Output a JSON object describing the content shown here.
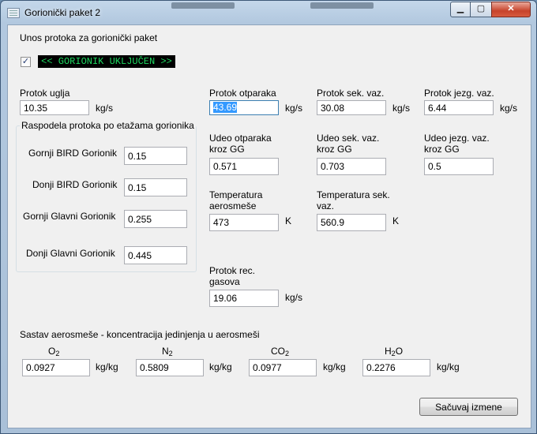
{
  "window": {
    "title": "Gorionički paket 2"
  },
  "caption_buttons": {
    "minimize": "▁",
    "maximize": "▢",
    "close": "✕"
  },
  "header": {
    "label": "Unos protoka za gorionički paket"
  },
  "burner": {
    "checked": true,
    "check_glyph": "✓",
    "status": "<< GORIONIK UKLJUČEN >>"
  },
  "coal": {
    "label": "Protok uglja",
    "value": "10.35",
    "unit": "kg/s"
  },
  "distribution": {
    "title": "Raspodela protoka po etažama gorionika",
    "rows": [
      {
        "label": "Gornji BIRD Gorionik",
        "value": "0.15"
      },
      {
        "label": "Donji BIRD Gorionik",
        "value": "0.15"
      },
      {
        "label": "Gornji Glavni Gorionik",
        "value": "0.255"
      },
      {
        "label": "Donji Glavni Gorionik",
        "value": "0.445"
      }
    ]
  },
  "flows": {
    "exhaust": {
      "label": "Protok otparaka",
      "value": "43.69",
      "unit": "kg/s"
    },
    "secondary": {
      "label": "Protok sek. vaz.",
      "value": "30.08",
      "unit": "kg/s"
    },
    "core": {
      "label": "Protok jezg. vaz.",
      "value": "6.44",
      "unit": "kg/s"
    }
  },
  "shares": {
    "exhaust": {
      "label": "Udeo otparaka kroz GG",
      "value": "0.571"
    },
    "secondary": {
      "label": "Udeo sek. vaz. kroz GG",
      "value": "0.703"
    },
    "core": {
      "label": "Udeo jezg. vaz. kroz GG",
      "value": "0.5"
    }
  },
  "temps": {
    "aeromix": {
      "label": "Temperatura aerosmeše",
      "value": "473",
      "unit": "K"
    },
    "secondary": {
      "label": "Temperatura sek. vaz.",
      "value": "560.9",
      "unit": "K"
    }
  },
  "recirc": {
    "label": "Protok rec. gasova",
    "value": "19.06",
    "unit": "kg/s"
  },
  "composition": {
    "title": "Sastav aerosmeše - koncentracija jedinjenja u aerosmeši",
    "items": [
      {
        "label_main": "O",
        "label_sub": "2",
        "label_rest": "",
        "value": "0.0927",
        "unit": "kg/kg"
      },
      {
        "label_main": "N",
        "label_sub": "2",
        "label_rest": "",
        "value": "0.5809",
        "unit": "kg/kg"
      },
      {
        "label_main": "CO",
        "label_sub": "2",
        "label_rest": "",
        "value": "0.0977",
        "unit": "kg/kg"
      },
      {
        "label_main": "H",
        "label_sub": "2",
        "label_rest": "O",
        "value": "0.2276",
        "unit": "kg/kg"
      }
    ]
  },
  "save_button": {
    "label": "Sačuvaj izmene"
  }
}
